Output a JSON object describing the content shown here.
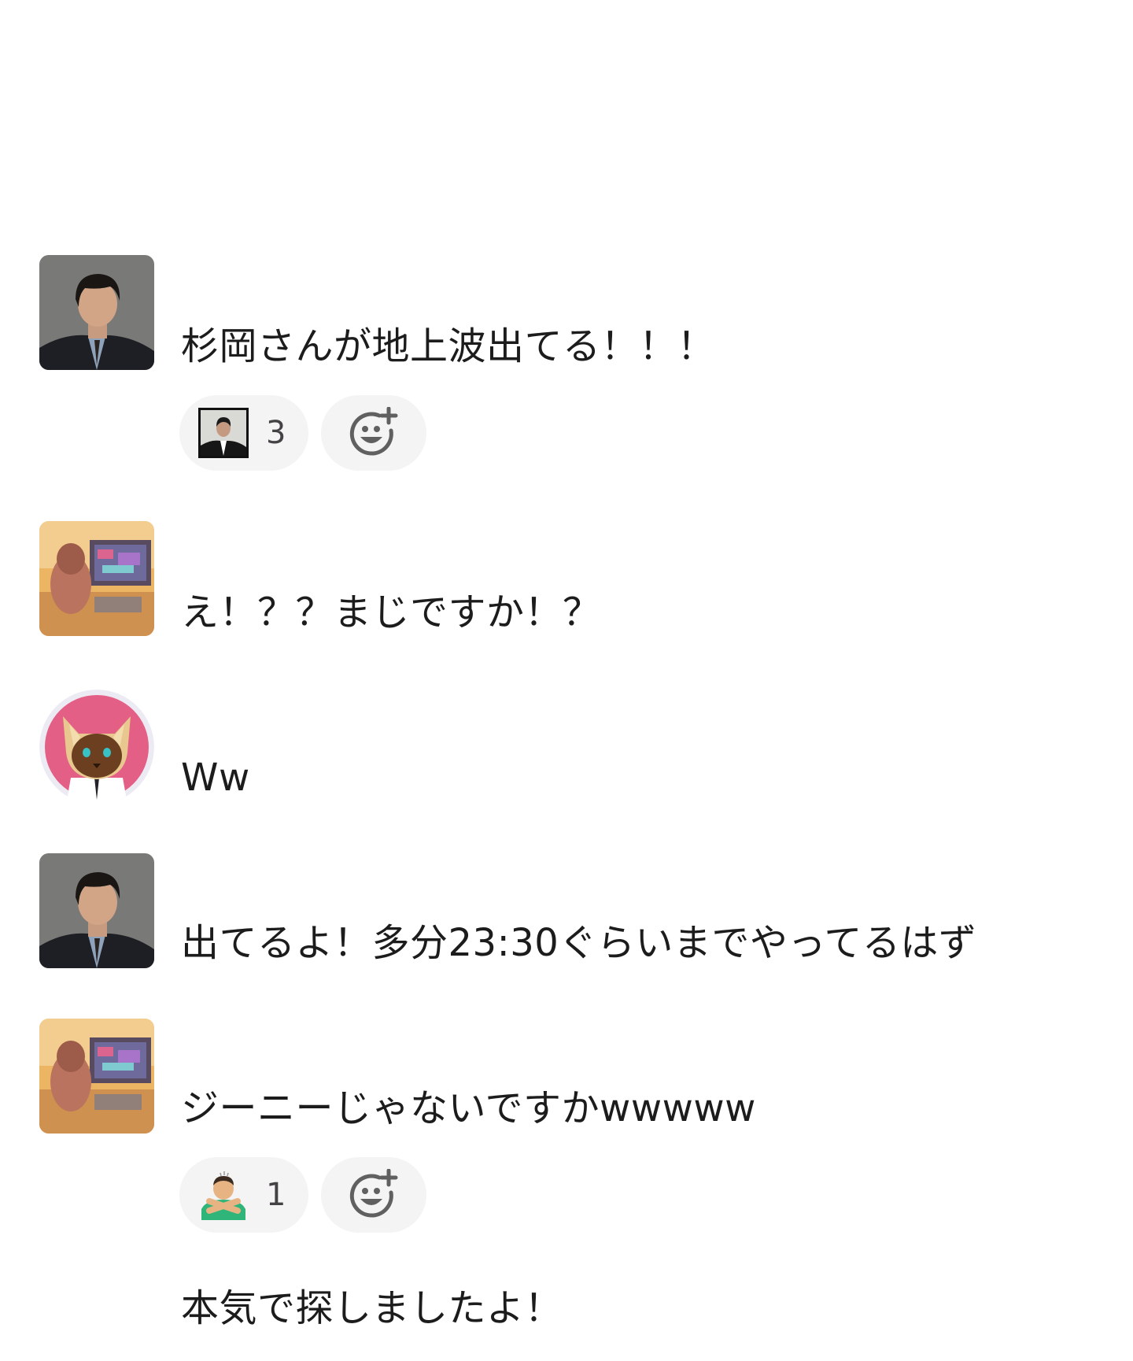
{
  "messages": [
    {
      "id": "m1",
      "avatar": "man-suit-avatar",
      "text": "杉岡さんが地上波出てる！！！",
      "reaction": {
        "icon": "man-suit-photo-emoji",
        "count": "3"
      }
    },
    {
      "id": "m2",
      "avatar": "pc-setup-avatar",
      "text": "え！？？まじですか！？"
    },
    {
      "id": "m3",
      "avatar": "cat-avatar",
      "text": "Ww"
    },
    {
      "id": "m4",
      "avatar": "man-suit-avatar",
      "text": "出てるよ！多分23:30ぐらいまでやってるはず"
    },
    {
      "id": "m5",
      "avatar": "pc-setup-avatar",
      "text": "ジーニーじゃないですかwwwww",
      "reaction": {
        "icon": "man-gesturing-no-emoji",
        "count": "1"
      }
    },
    {
      "id": "m6",
      "text": "本気で探しましたよ！"
    }
  ],
  "colors": {
    "pill_bg": "#f4f4f4",
    "text": "#1d1c1d",
    "count": "#454245",
    "icon_gray": "#616061"
  }
}
